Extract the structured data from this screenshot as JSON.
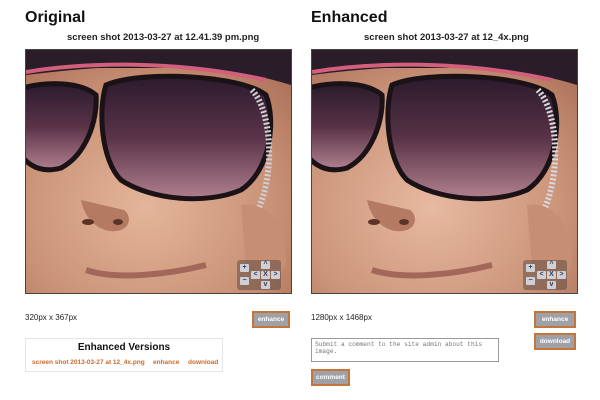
{
  "original": {
    "heading": "Original",
    "filename": "screen shot 2013-03-27 at 12.41.39 pm.png",
    "dimensions": "320px x 367px",
    "enhance_label": "enhance"
  },
  "enhanced": {
    "heading": "Enhanced",
    "filename": "screen shot 2013-03-27 at 12_4x.png",
    "dimensions": "1280px x 1468px",
    "enhance_label": "enhance",
    "download_label": "download",
    "comment_placeholder": "Submit a comment to the site admin about this image.",
    "comment_label": "comment"
  },
  "enhanced_versions": {
    "title": "Enhanced Versions",
    "items": [
      {
        "file": "screen shot 2013-03-27 at 12_4x.png",
        "enhance": "enhance",
        "download": "download"
      }
    ]
  },
  "zoom_controls": {
    "zoom_in": "+",
    "zoom_out": "−",
    "up": "^",
    "down": "v",
    "left": "<",
    "right": ">",
    "reset": "X"
  },
  "colors": {
    "accent_orange": "#c6753a",
    "link_orange": "#cc6a2a",
    "button_gray": "#9fa1a6",
    "lens_purple": "#3b2040"
  },
  "icons": [
    "zoom-in-icon",
    "zoom-out-icon",
    "pan-up-icon",
    "pan-down-icon",
    "pan-left-icon",
    "pan-right-icon",
    "reset-icon"
  ]
}
